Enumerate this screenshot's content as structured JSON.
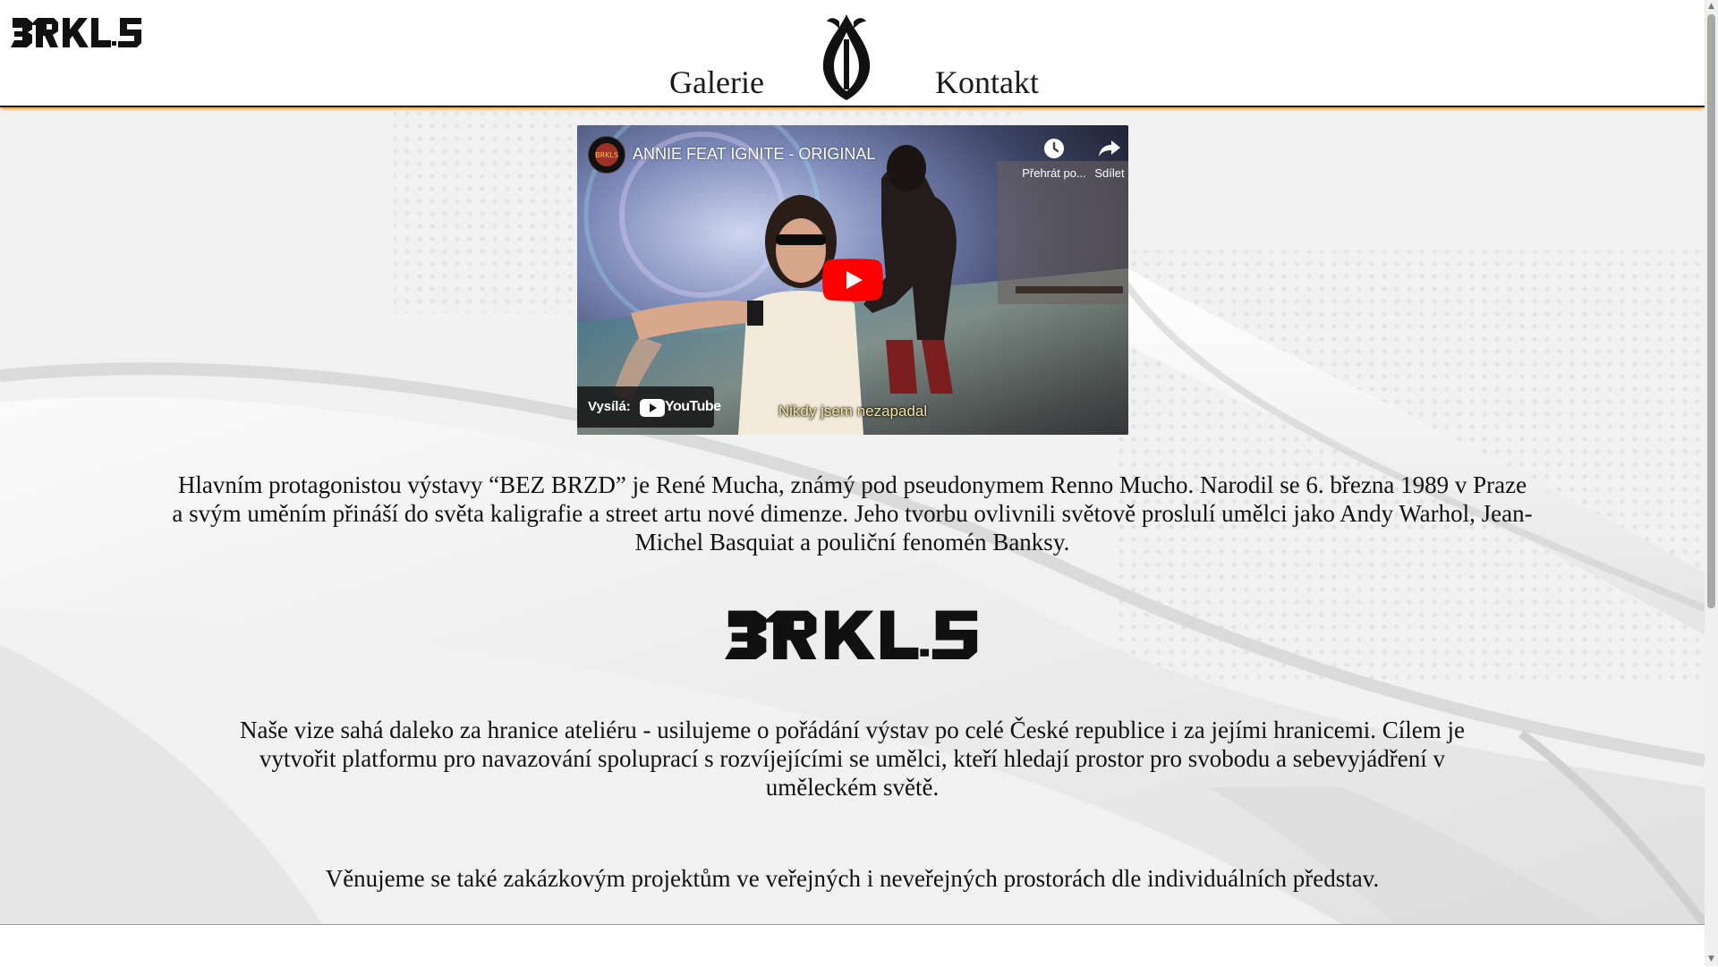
{
  "header": {
    "logo_text": "BRKLS",
    "nav": [
      {
        "label": "Galerie"
      },
      {
        "label": "Kontakt"
      }
    ]
  },
  "video": {
    "title": "ANNIE FEAT IGNITE - ORIGINAL",
    "watch_later_label": "Přehrát po...",
    "share_label": "Sdílet",
    "provided_by_label": "Vysílá:",
    "platform": "YouTube",
    "caption": "Nikdy jsem nezapadal",
    "play_color": "#ff0000"
  },
  "content": {
    "paragraph_1": "Hlavním protagonistou výstavy “BEZ BRZD” je René Mucha, známý pod pseudonymem Renno Mucho. Narodil se 6. března 1989 v Praze a svým uměním přináší do světa kaligrafie a street artu nové dimenze. Jeho tvorbu ovlivnili světově proslulí umělci jako Andy Warhol, Jean-Michel Basquiat a pouliční fenomén Banksy.",
    "logo_text": "BRKLS",
    "paragraph_2": "Naše vize sahá daleko za hranice ateliéru - usilujeme o pořádání výstav po celé České republice i za jejími hranicemi. Cílem je vytvořit platformu pro navazování spoluprací s rozvíjejícími se umělci, kteří hledají prostor pro svobodu a sebevyjádření v uměleckém světě.",
    "paragraph_3": "Věnujeme se také zakázkovým projektům ve veřejných i neveřejných prostorách dle individuálních představ."
  },
  "colors": {
    "accent": "#f39a2c",
    "text": "#111111",
    "background": "#f1f1f1"
  },
  "icons": [
    "brkls-logo",
    "emblem-icon",
    "clock-icon",
    "share-icon",
    "play-icon",
    "youtube-icon"
  ]
}
